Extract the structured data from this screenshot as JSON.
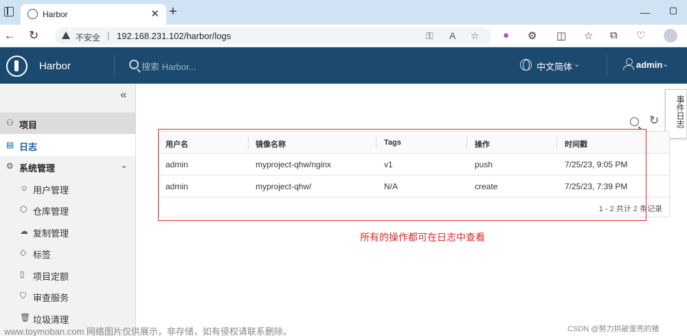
{
  "browser": {
    "tab_title": "Harbor",
    "tab_close": "✕",
    "new_tab": "+",
    "minimize": "—",
    "insecure_label": "不安全",
    "separator": "|",
    "url": "192.168.231.102/harbor/logs"
  },
  "header": {
    "app_name": "Harbor",
    "search_placeholder": "搜索 Harbor...",
    "language": "中文简体",
    "user": "admin"
  },
  "sidebar": {
    "collapse": "«",
    "items": [
      {
        "label": "项目",
        "icon": "projects-icon"
      },
      {
        "label": "日志",
        "icon": "logs-icon"
      },
      {
        "label": "系统管理",
        "icon": "admin-icon"
      }
    ],
    "sub_items": [
      {
        "label": "用户管理",
        "icon": "users-icon"
      },
      {
        "label": "仓库管理",
        "icon": "registry-icon"
      },
      {
        "label": "复制管理",
        "icon": "replication-icon"
      },
      {
        "label": "标签",
        "icon": "tag-icon"
      },
      {
        "label": "项目定额",
        "icon": "quota-icon"
      },
      {
        "label": "审查服务",
        "icon": "shield-icon"
      },
      {
        "label": "垃圾清理",
        "icon": "trash-icon"
      }
    ]
  },
  "side_tab": "事件日志",
  "logs": {
    "columns": [
      "用户名",
      "镜像名称",
      "Tags",
      "操作",
      "时间戳"
    ],
    "rows": [
      [
        "admin",
        "myproject-qhw/nginx",
        "v1",
        "push",
        "7/25/23, 9:05 PM"
      ],
      [
        "admin",
        "myproject-qhw/",
        "N/A",
        "create",
        "7/25/23, 7:39 PM"
      ]
    ],
    "footer": "1 - 2 共计 2 条记录"
  },
  "annotation": "所有的操作都可在日志中查看",
  "watermark_left": "www.toymoban.com 网络图片仅供展示，非存储，如有侵权请联系删除。",
  "watermark_right": "CSDN @努力拱破蛋壳的猪",
  "colors": {
    "header_bg": "#1b4a6e",
    "accent": "#0d63a5",
    "highlight": "#e0282b"
  }
}
